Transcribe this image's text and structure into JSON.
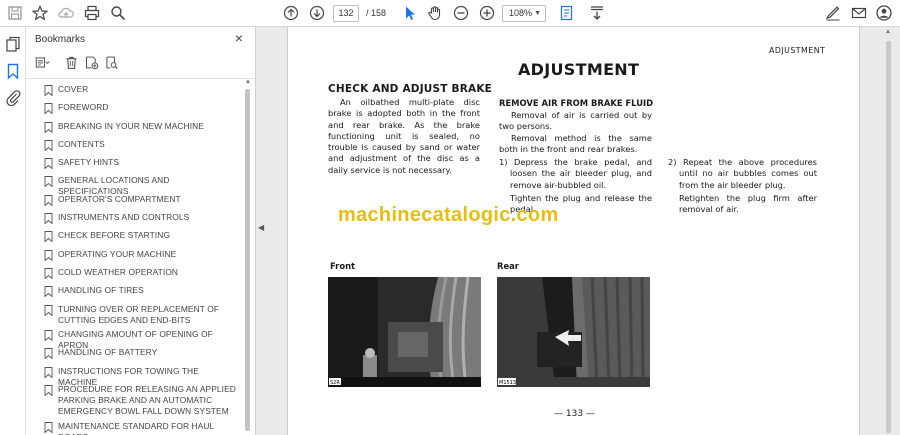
{
  "toolbar": {
    "page_current": "132",
    "page_total": "/ 158",
    "zoom": "108%"
  },
  "panel": {
    "title": "Bookmarks",
    "items": [
      {
        "label": "COVER"
      },
      {
        "label": "FOREWORD"
      },
      {
        "label": "BREAKING IN YOUR NEW MACHINE"
      },
      {
        "label": "CONTENTS"
      },
      {
        "label": "SAFETY HINTS"
      },
      {
        "label": "GENERAL LOCATIONS AND SPECIFICATIONS"
      },
      {
        "label": "OPERATOR'S COMPARTMENT"
      },
      {
        "label": "INSTRUMENTS AND CONTROLS"
      },
      {
        "label": "CHECK BEFORE STARTING"
      },
      {
        "label": "OPERATING YOUR MACHINE"
      },
      {
        "label": "COLD WEATHER OPERATION"
      },
      {
        "label": "HANDLING OF TIRES"
      },
      {
        "label": "TURNING OVER OR REPLACEMENT OF CUTTING EDGES AND END-BITS"
      },
      {
        "label": "CHANGING AMOUNT OF OPENING OF APRON"
      },
      {
        "label": "HANDLING OF BATTERY"
      },
      {
        "label": "INSTRUCTIONS FOR TOWING THE MACHINE"
      },
      {
        "label": "PROCEDURE FOR RELEASING AN APPLIED PARKING BRAKE AND AN AUTOMATIC EMERGENCY BOWL FALL DOWN SYSTEM"
      },
      {
        "label": "MAINTENANCE STANDARD FOR HAUL ROADS"
      }
    ]
  },
  "document": {
    "header_right": "ADJUSTMENT",
    "main_title": "ADJUSTMENT",
    "section_title": "CHECK AND ADJUST BRAKE",
    "section_body": "An oilbathed multi-plate disc brake is adopted both in the front and rear brake. As the brake functioning unit is sealed, no trouble is caused by sand or water and adjustment of the disc as a daily service is not necessary.",
    "sub_title": "REMOVE AIR FROM BRAKE FLUID",
    "sub_para1": "Removal of air is carried out by two persons.",
    "sub_para2": "Removal method is the same both in the front and rear brakes.",
    "step1": "1)  Depress the brake pedal, and loosen the air bleeder plug, and remove air-bubbled oil.",
    "step1_cont": "Tighten the plug and release the pedal.",
    "step2": "2)  Repeat the above procedures until no air bubbles comes out from the air bleeder plug.",
    "step2_cont": "Retighten the plug firm after removal of air.",
    "watermark": "machinecatalogic.com",
    "photo_front_label": "Front",
    "photo_rear_label": "Rear",
    "photo_front_code": "S2R",
    "photo_rear_code": "M1513",
    "page_number": "— 133 —"
  },
  "colors": {
    "watermark": "#e5be0e",
    "accent_blue": "#1a73e8"
  }
}
